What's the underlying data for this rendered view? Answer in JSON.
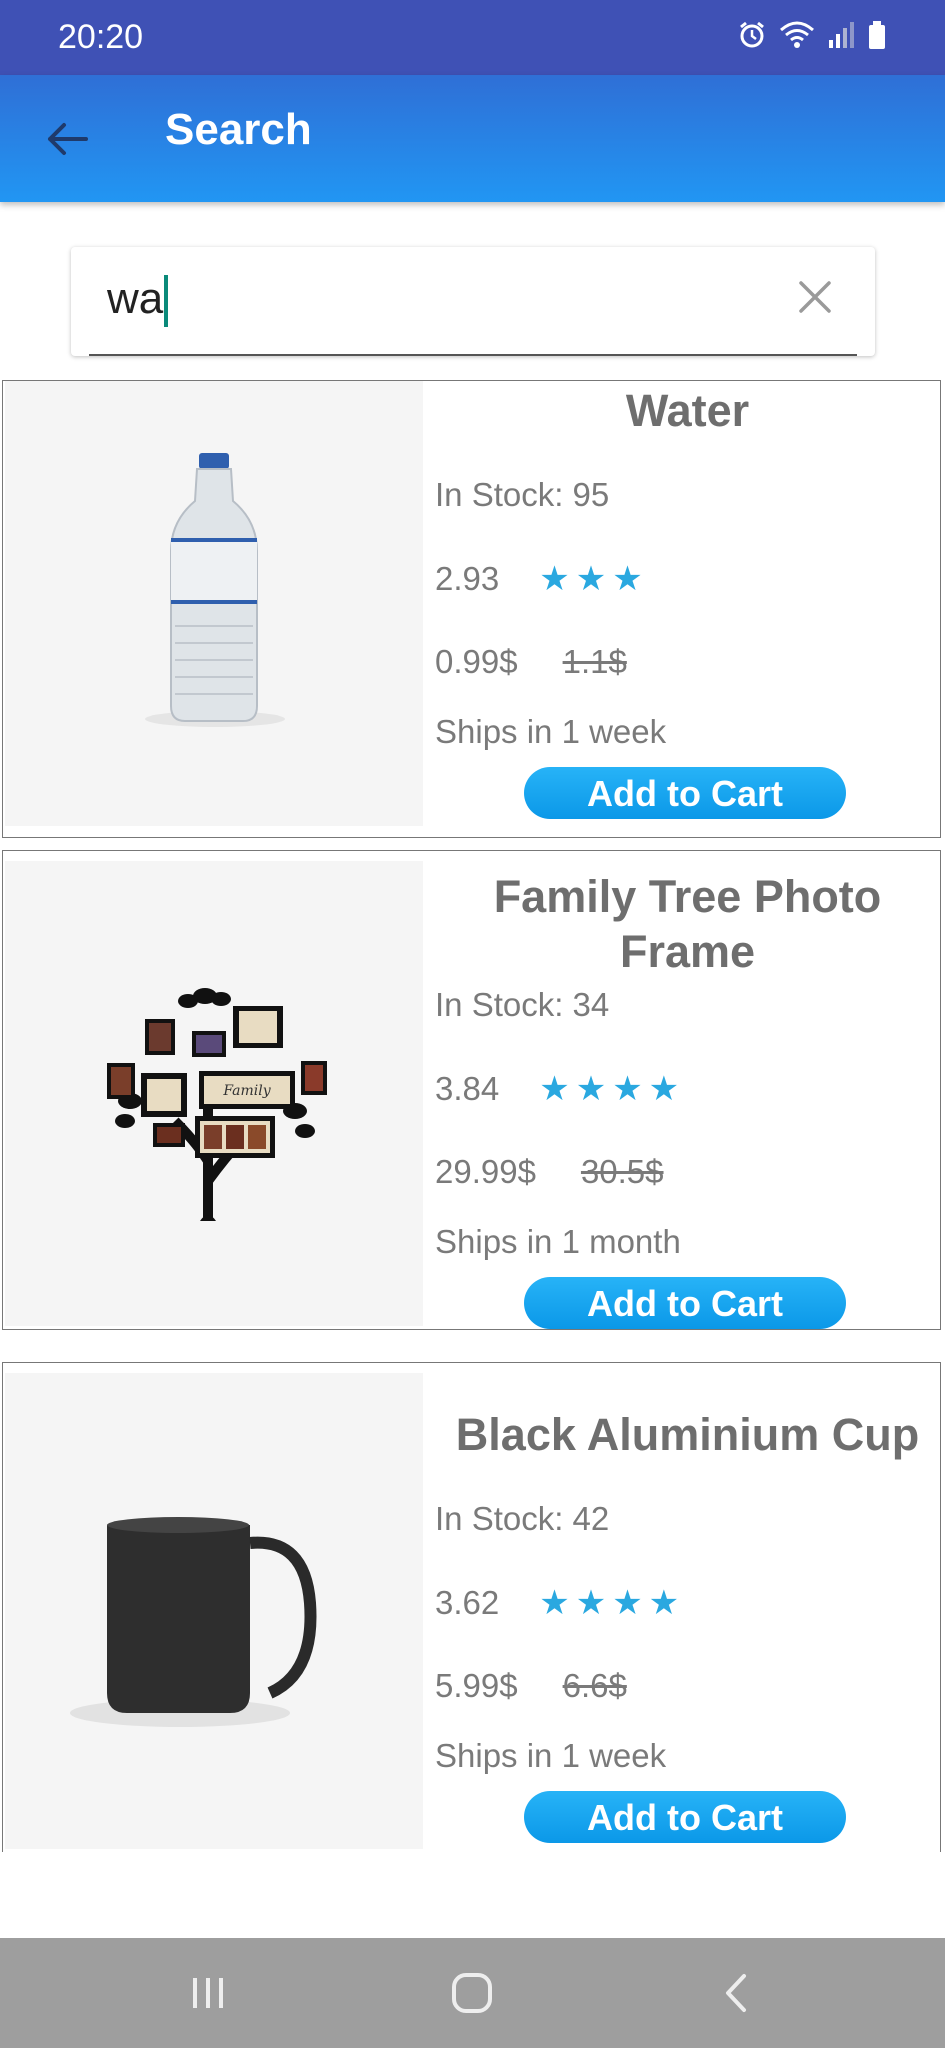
{
  "status_bar": {
    "time": "20:20"
  },
  "app_bar": {
    "title": "Search"
  },
  "search": {
    "value": "wa"
  },
  "products": [
    {
      "name": "Water",
      "stock": "In Stock: 95",
      "rating": "2.93",
      "rating_stars": 3,
      "price": "0.99$",
      "old_price": "1.1$",
      "shipping": "Ships in 1 week",
      "button": "Add to Cart"
    },
    {
      "name": "Family Tree Photo Frame",
      "stock": "In Stock: 34",
      "rating": "3.84",
      "rating_stars": 4,
      "price": "29.99$",
      "old_price": "30.5$",
      "shipping": "Ships in 1 month",
      "button": "Add to Cart"
    },
    {
      "name": "Black Aluminium Cup",
      "stock": "In Stock: 42",
      "rating": "3.62",
      "rating_stars": 4,
      "price": "5.99$",
      "old_price": "6.6$",
      "shipping": "Ships in 1 week",
      "button": "Add to Cart"
    }
  ],
  "colors": {
    "status_bar": "#3f51b5",
    "app_bar": "#2196f3",
    "star": "#2aa8e0",
    "button": "#0b98e8",
    "nav_bar": "#9e9e9e"
  }
}
